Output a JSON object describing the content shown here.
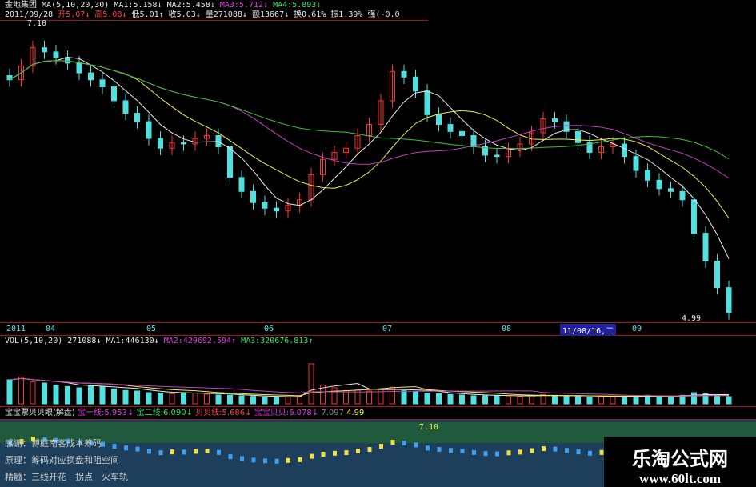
{
  "header": {
    "stock": "金地集团",
    "ma_params": "MA(5,10,20,30)",
    "ma1": "MA1:5.158↓",
    "ma2": "MA2:5.458↓",
    "ma3": "MA3:5.712↓",
    "ma4": "MA4:5.893↓",
    "date": "2011/09/28",
    "open": "开5.07↓",
    "high": "高5.08↓",
    "low": "低5.01↑",
    "close": "收5.03↓",
    "volume": "量271088↓",
    "amount": "额13667↓",
    "turnover": "换0.61%",
    "amplitude": "振1.39%",
    "strength": "强(-0.0"
  },
  "price_labels": {
    "max": "7.10",
    "min": "4.99"
  },
  "date_axis": {
    "labels": [
      "2011",
      "04",
      "05",
      "06",
      "07",
      "08",
      "09"
    ],
    "cursor": "11/08/16,二"
  },
  "vol_header": {
    "params": "VOL(5,10,20)",
    "vol": "271088↓",
    "ma1": "MA1:446130↓",
    "ma2": "MA2:429692.594↑",
    "ma3": "MA3:320676.813↑"
  },
  "indicator": {
    "title": "宝宝票贝贝眼(解盘)",
    "l1": "宝一线:5.953↓",
    "l2": "宝二线:6.090↓",
    "l3": "贝贝线:5.686↓",
    "l4": "宝宝贝贝:6.078↓",
    "v1": "7.097",
    "v2": "4.99",
    "max": "7.10",
    "notes": [
      "感谢：博庭南客成本筹码",
      "原理：筹码对应换盘和阻空间",
      "精髓：三线开花　拐点　火车轨"
    ]
  },
  "watermark": {
    "name": "乐淘公式网",
    "url": "www.60lt.com"
  },
  "chart_data": {
    "type": "candlestick",
    "title": "",
    "ylim": [
      4.99,
      7.1
    ],
    "close": [
      6.7,
      6.8,
      6.93,
      6.9,
      6.86,
      6.82,
      6.75,
      6.7,
      6.65,
      6.55,
      6.46,
      6.4,
      6.28,
      6.21,
      6.25,
      6.24,
      6.28,
      6.3,
      6.22,
      6.0,
      5.9,
      5.82,
      5.78,
      5.76,
      5.8,
      5.84,
      6.02,
      6.13,
      6.18,
      6.21,
      6.3,
      6.38,
      6.55,
      6.76,
      6.72,
      6.62,
      6.45,
      6.38,
      6.33,
      6.3,
      6.22,
      6.16,
      6.15,
      6.2,
      6.24,
      6.32,
      6.42,
      6.4,
      6.33,
      6.25,
      6.18,
      6.22,
      6.24,
      6.15,
      6.05,
      5.98,
      5.92,
      5.9,
      5.84,
      5.6,
      5.4,
      5.21,
      5.03
    ],
    "volume": [
      900000,
      1000000,
      820000,
      780000,
      700000,
      650000,
      600000,
      700000,
      650000,
      560000,
      500000,
      480000,
      420000,
      400000,
      380000,
      420000,
      400000,
      360000,
      330000,
      320000,
      300000,
      280000,
      260000,
      250000,
      260000,
      280000,
      1500000,
      700000,
      600000,
      500000,
      520000,
      480000,
      560000,
      620000,
      500000,
      450000,
      400000,
      380000,
      350000,
      330000,
      300000,
      300000,
      320000,
      300000,
      280000,
      300000,
      340000,
      320000,
      300000,
      280000,
      260000,
      280000,
      270000,
      260000,
      300000,
      320000,
      300000,
      280000,
      320000,
      420000,
      380000,
      330000,
      271088
    ],
    "ma_periods": [
      5,
      10,
      20,
      30
    ],
    "ma_colors": [
      "#e8e8e8",
      "#f0f040",
      "#c040c0",
      "#40c040"
    ]
  }
}
